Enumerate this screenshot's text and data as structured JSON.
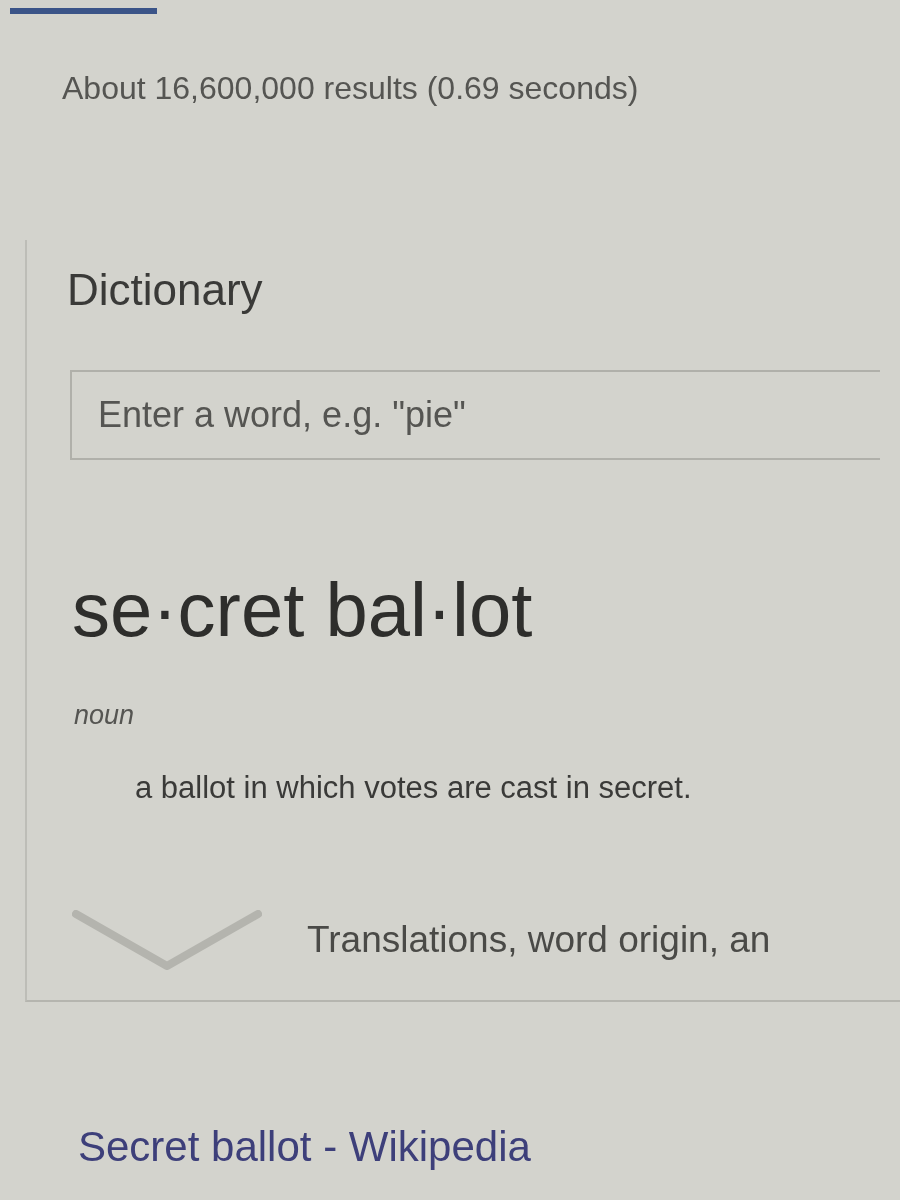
{
  "result_stats": "About 16,600,000 results (0.69 seconds)",
  "dictionary": {
    "title": "Dictionary",
    "search": {
      "placeholder": "Enter a word, e.g. \"pie\""
    },
    "headword": "se·cret bal·lot",
    "part_of_speech": "noun",
    "definitions": [
      "a ballot in which votes are cast in secret."
    ],
    "more": {
      "label": "Translations, word origin, an",
      "expanded": false
    }
  },
  "results": [
    {
      "title": "Secret ballot - Wikipedia"
    }
  ]
}
